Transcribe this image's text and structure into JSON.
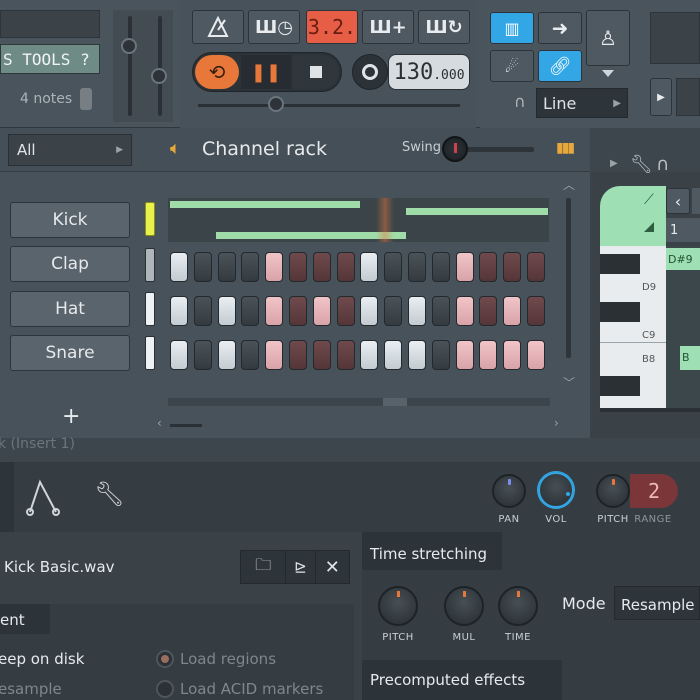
{
  "toolbar": {
    "tools_label": "S TOOLS ?",
    "notes_label": "4 notes",
    "time_display": "3.2.",
    "tempo_value": "130",
    "tempo_decimals": ".000",
    "snap_mode": "Line",
    "accent_color": "#e8773a",
    "blue_color": "#33a7e6"
  },
  "rack": {
    "filter_value": "All",
    "title": "Channel rack",
    "swing_label": "Swing",
    "add_label": "+",
    "channels": [
      {
        "name": "Kick"
      },
      {
        "name": "Clap"
      },
      {
        "name": "Hat"
      },
      {
        "name": "Snare"
      }
    ],
    "footer_partial": "k (Insert 1)"
  },
  "piano": {
    "bar_number": "1",
    "notes": [
      "D#9",
      "D9",
      "C9",
      "B8"
    ],
    "marker": "B"
  },
  "channel_settings": {
    "pan_label": "PAN",
    "vol_label": "VOL",
    "pitch_label": "PITCH",
    "range_label": "RANGE",
    "range_value": "2"
  },
  "sample": {
    "file_name": "Kick Basic.wav",
    "section_partial": "ent",
    "keep_on_disk": "eep on disk",
    "resample": "esample",
    "load_regions": "Load regions",
    "load_acid": "Load ACID markers",
    "time_stretching_title": "Time stretching",
    "ts_pitch": "PITCH",
    "ts_mul": "MUL",
    "ts_time": "TIME",
    "mode_label": "Mode",
    "mode_value": "Resample",
    "precomputed_title": "Precomputed effects"
  }
}
